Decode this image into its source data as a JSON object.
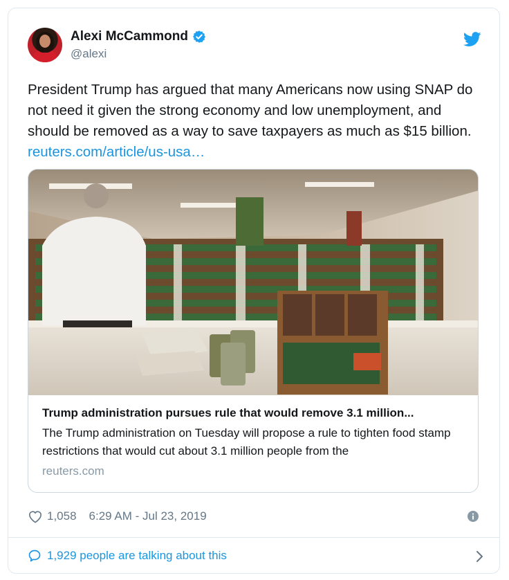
{
  "author": {
    "display_name": "Alexi McCammond",
    "handle": "@alexi",
    "verified": true
  },
  "tweet": {
    "text": "President Trump has argued that many Americans now using SNAP do not need it given the strong economy and low unemployment, and should be removed as a way to save taxpayers as much as $15 billion.",
    "link_text": "reuters.com/article/us-usa…"
  },
  "link_card": {
    "title": "Trump administration pursues rule that would remove 3.1 million...",
    "description": "The Trump administration on Tuesday will propose a rule to tighten food stamp restrictions that would cut about 3.1 million people from the",
    "domain": "reuters.com",
    "image_icon": "food-pantry-photo"
  },
  "meta": {
    "like_count": "1,058",
    "timestamp": "6:29 AM - Jul 23, 2019"
  },
  "conversation": {
    "label": "1,929 people are talking about this"
  },
  "colors": {
    "link": "#1b95e0",
    "muted": "#657786",
    "border": "#e1e8ed",
    "twitter_blue": "#1da1f2"
  },
  "icons": {
    "verified": "verified-badge-icon",
    "brand": "twitter-bird-icon",
    "like": "heart-icon",
    "info": "info-icon",
    "reply": "speech-bubble-icon",
    "more": "chevron-right-icon"
  }
}
